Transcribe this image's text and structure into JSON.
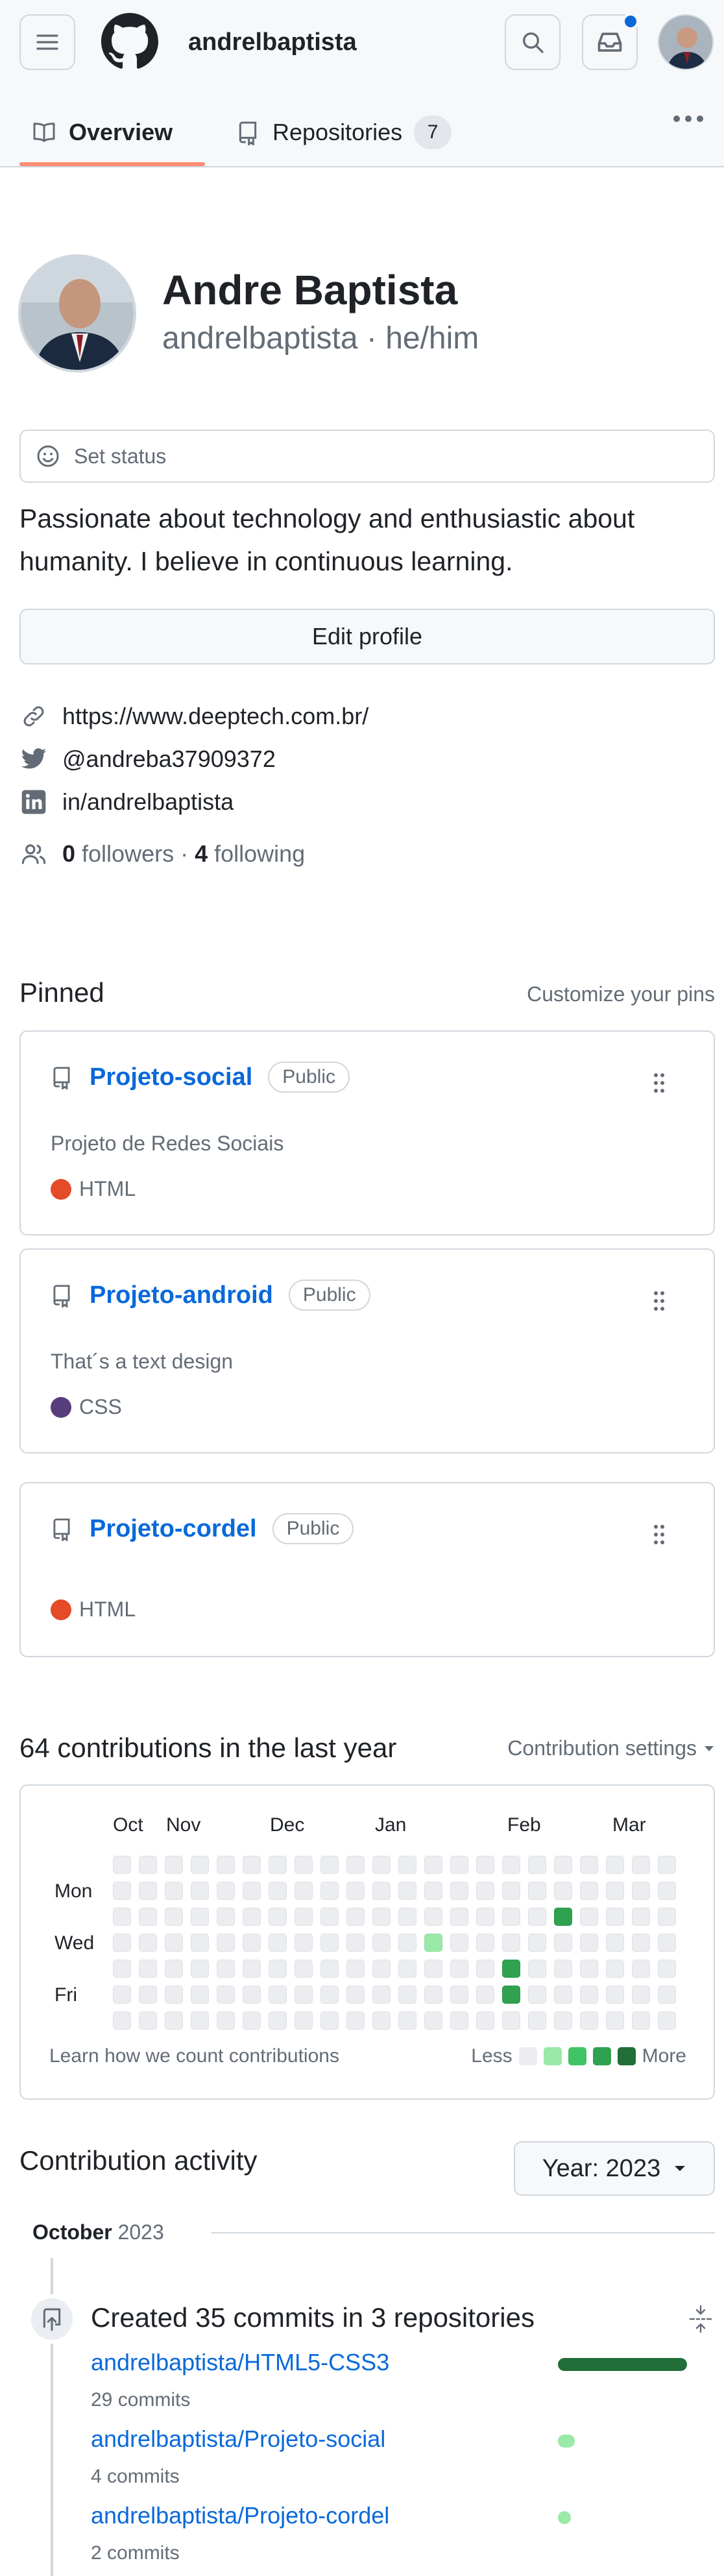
{
  "header": {
    "username": "andrelbaptista",
    "icons": {
      "menu": "hamburger-icon",
      "logo": "github-mark-icon",
      "search": "search-icon",
      "inbox": "inbox-icon",
      "avatar": "avatar"
    },
    "inbox_unread_dot": true
  },
  "tabs": [
    {
      "label": "Overview",
      "icon": "book-icon",
      "active": true
    },
    {
      "label": "Repositories",
      "icon": "repo-icon",
      "count": "7"
    }
  ],
  "profile": {
    "name": "Andre Baptista",
    "login_line": "andrelbaptista · he/him",
    "set_status": "Set status",
    "bio": "Passionate about technology and enthusiastic about humanity. I believe in continuous learning.",
    "edit_profile": "Edit profile",
    "website": "https://www.deeptech.com.br/",
    "twitter": "@andreba37909372",
    "linkedin": "in/andrelbaptista",
    "followers_count": "0",
    "followers_label": "followers",
    "separator": "·",
    "following_count": "4",
    "following_label": "following"
  },
  "pinned": {
    "title": "Pinned",
    "customize": "Customize your pins",
    "items": [
      {
        "name": "Projeto-social",
        "visibility": "Public",
        "description": "Projeto de Redes Sociais",
        "language": "HTML",
        "language_color": "#e34c26"
      },
      {
        "name": "Projeto-android",
        "visibility": "Public",
        "description": "That´s a text design",
        "language": "CSS",
        "language_color": "#563d7c"
      },
      {
        "name": "Projeto-cordel",
        "visibility": "Public",
        "description": "",
        "language": "HTML",
        "language_color": "#e34c26"
      }
    ]
  },
  "contributions": {
    "title": "64 contributions in the last year",
    "settings": "Contribution settings",
    "months": [
      "Oct",
      "Nov",
      "Dec",
      "Jan",
      "Feb",
      "Mar"
    ],
    "days": [
      "Mon",
      "Wed",
      "Fri"
    ],
    "weeks": 22,
    "active_cells": [
      {
        "week": 17,
        "day": 2,
        "level": 3
      },
      {
        "week": 12,
        "day": 3,
        "level": 1
      },
      {
        "week": 15,
        "day": 4,
        "level": 3
      },
      {
        "week": 15,
        "day": 5,
        "level": 3
      }
    ],
    "footer": "Learn how we count contributions",
    "legend_less": "Less",
    "legend_more": "More",
    "level_colors": [
      "#ebedf0",
      "#9be9a8",
      "#40c463",
      "#30a14e",
      "#216e39"
    ]
  },
  "activity": {
    "title": "Contribution activity",
    "year_button": "Year: 2023",
    "month": "October",
    "year": "2023",
    "summary": "Created 35 commits in 3 repositories",
    "repos": [
      {
        "name": "andrelbaptista/HTML5-CSS3",
        "commits": "29 commits",
        "share": 0.83,
        "color": "#216e39"
      },
      {
        "name": "andrelbaptista/Projeto-social",
        "commits": "4 commits",
        "share": 0.11,
        "color": "#9be9a8"
      },
      {
        "name": "andrelbaptista/Projeto-cordel",
        "commits": "2 commits",
        "share": 0.06,
        "color": "#9be9a8"
      }
    ]
  }
}
